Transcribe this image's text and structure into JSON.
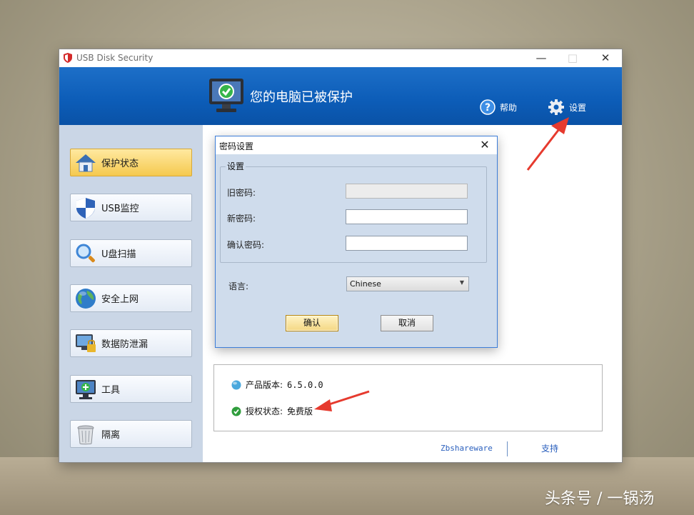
{
  "window": {
    "title": "USB Disk Security",
    "controls": {
      "minimize": "—",
      "maximize": "□",
      "close": "✕"
    }
  },
  "banner": {
    "status_text": "您的电脑已被保护",
    "help_label": "帮助",
    "settings_label": "设置"
  },
  "sidebar": {
    "items": [
      {
        "label": "保护状态",
        "icon": "home-shield-icon",
        "active": true
      },
      {
        "label": "USB监控",
        "icon": "shield-icon",
        "active": false
      },
      {
        "label": "U盘扫描",
        "icon": "magnifier-icon",
        "active": false
      },
      {
        "label": "安全上网",
        "icon": "globe-icon",
        "active": false
      },
      {
        "label": "数据防泄漏",
        "icon": "monitor-lock-icon",
        "active": false
      },
      {
        "label": "工具",
        "icon": "tools-monitor-icon",
        "active": false
      },
      {
        "label": "隔离",
        "icon": "trash-bin-icon",
        "active": false
      }
    ]
  },
  "info": {
    "version_label": "产品版本:",
    "version_value": "6.5.0.0",
    "license_label": "授权状态:",
    "license_value": "免费版"
  },
  "footer": {
    "left_link": "Zbshareware",
    "right_link": "支持"
  },
  "dialog": {
    "title": "密码设置",
    "group_label": "设置",
    "old_password_label": "旧密码:",
    "new_password_label": "新密码:",
    "confirm_password_label": "确认密码:",
    "old_password_value": "",
    "new_password_value": "",
    "confirm_password_value": "",
    "language_label": "语言:",
    "language_value": "Chinese",
    "ok_label": "确认",
    "cancel_label": "取消"
  },
  "watermark": "头条号 / 一锅汤",
  "colors": {
    "banner_blue": "#0c5cb7",
    "sidebar_bg": "#cad6e6",
    "active_item": "#f5c94f",
    "arrow_red": "#e63a2e",
    "dialog_body": "#cfdcec"
  }
}
